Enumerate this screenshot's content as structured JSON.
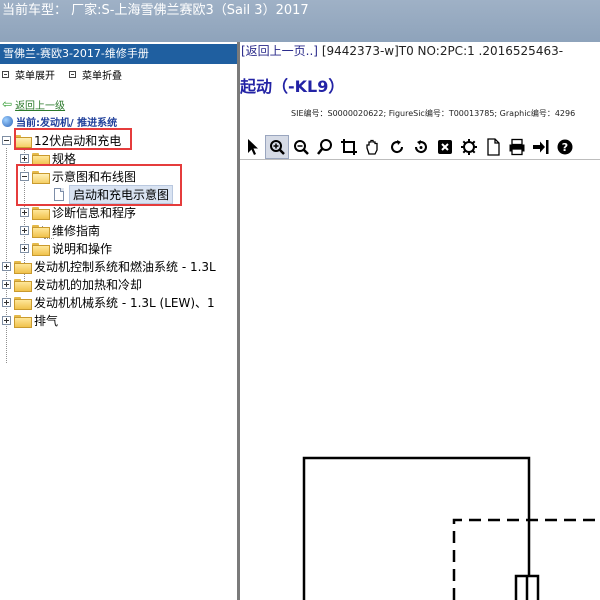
{
  "window": {
    "title": "当前车型： 厂家:S-上海雪佛兰赛欧3（Sail 3）2017"
  },
  "left_panel": {
    "header": "雪佛兰-赛欧3-2017-维修手册",
    "expand_label": "菜单展开",
    "collapse_label": "菜单折叠",
    "back_link": "返回上一级",
    "current_path": "当前:发动机/ 推进系统",
    "tree": [
      {
        "label": "12伏启动和充电",
        "level": 0,
        "state": "open"
      },
      {
        "label": "规格",
        "level": 1,
        "state": "closed"
      },
      {
        "label": "示意图和布线图",
        "level": 1,
        "state": "open"
      },
      {
        "label": "启动和充电示意图",
        "level": 2,
        "state": "leaf",
        "selected": true
      },
      {
        "label": "诊断信息和程序",
        "level": 1,
        "state": "closed"
      },
      {
        "label": "维修指南",
        "level": 1,
        "state": "closed"
      },
      {
        "label": "说明和操作",
        "level": 1,
        "state": "closed"
      },
      {
        "label": "发动机控制系统和燃油系统 - 1.3L",
        "level": 0,
        "state": "closed"
      },
      {
        "label": "发动机的加热和冷却",
        "level": 0,
        "state": "closed"
      },
      {
        "label": "发动机机械系统 - 1.3L (LEW)、1",
        "level": 0,
        "state": "closed"
      },
      {
        "label": "排气",
        "level": 0,
        "state": "closed"
      }
    ]
  },
  "right_panel": {
    "back_link": "[返回上一页..]",
    "doc_info": "[9442373-w]T0 NO:2PC:1 .2016525463-",
    "title": "起动（-KL9）",
    "meta": "SIE编号：S0000020622; FigureSic编号：T00013785; Graphic编号：4296"
  },
  "toolbar": {
    "tools": [
      "pointer-icon",
      "zoom-box-icon",
      "zoom-out-icon",
      "zoom-in-icon",
      "crop-icon",
      "pan-hand-icon",
      "rotate-right-icon",
      "rotate-left-icon",
      "fit-icon",
      "settings-icon",
      "document-icon",
      "print-icon",
      "export-icon",
      "help-icon"
    ]
  },
  "colors": {
    "titlebar": "#9fb1c6",
    "left_header": "#1f5fa0",
    "link_green": "#2b7a2b",
    "path_blue": "#1f3f9a",
    "doc_title": "#2323a5",
    "highlight_red": "#e53c3c"
  }
}
